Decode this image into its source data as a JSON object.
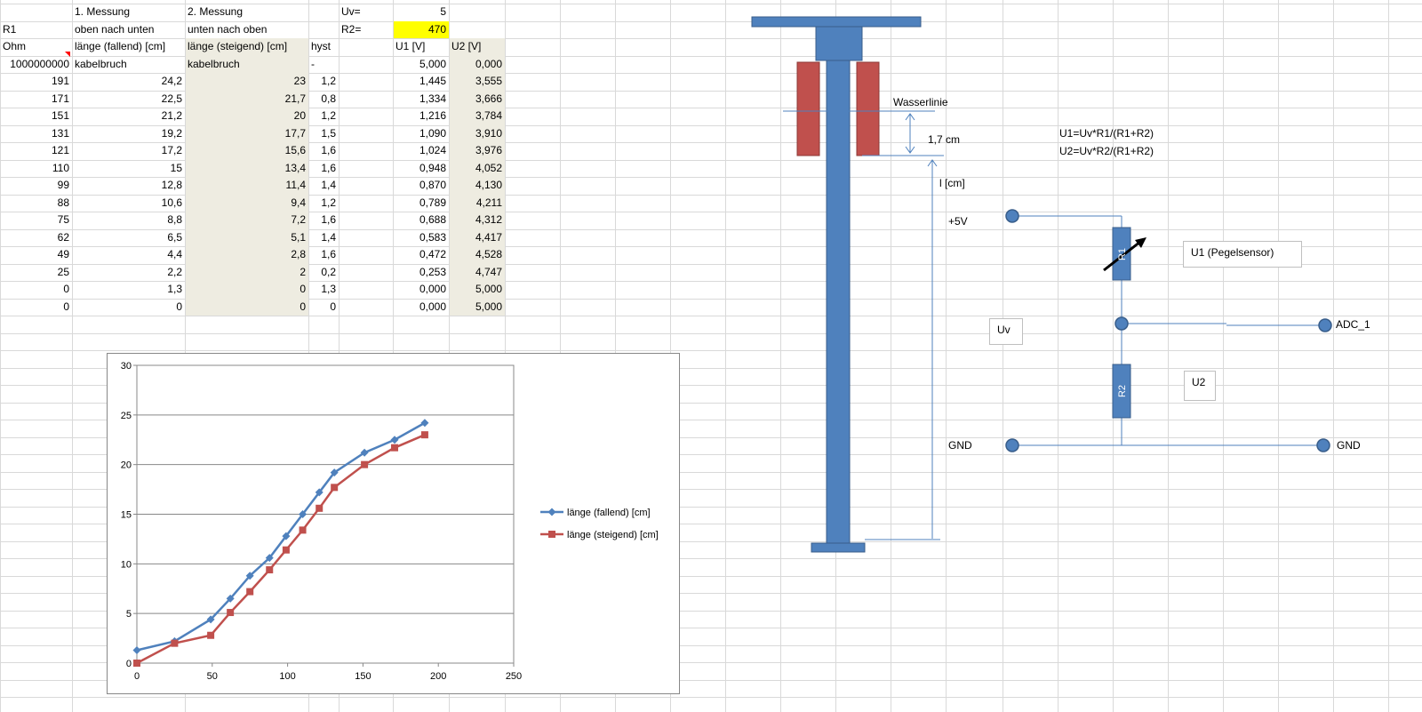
{
  "sheet": {
    "top_rows": [
      {
        "b": "1. Messung",
        "c": "2. Messung",
        "e": "Uv=",
        "f": "5"
      },
      {
        "a": "R1",
        "b": "oben nach unten",
        "c": "unten nach oben",
        "e": "R2=",
        "f": "470"
      },
      {
        "a": "Ohm",
        "b": "länge (fallend) [cm]",
        "c": "länge (steigend)  [cm]",
        "d": "hyst",
        "f": "U1 [V]",
        "g": "U2  [V]"
      },
      {
        "a": "1000000000",
        "b": "kabelbruch",
        "c": "kabelbruch",
        "d": "-",
        "f": "5,000",
        "g": "0,000"
      }
    ],
    "rows": [
      {
        "a": "191",
        "b": "24,2",
        "c": "23",
        "d": "1,2",
        "f": "1,445",
        "g": "3,555"
      },
      {
        "a": "171",
        "b": "22,5",
        "c": "21,7",
        "d": "0,8",
        "f": "1,334",
        "g": "3,666"
      },
      {
        "a": "151",
        "b": "21,2",
        "c": "20",
        "d": "1,2",
        "f": "1,216",
        "g": "3,784"
      },
      {
        "a": "131",
        "b": "19,2",
        "c": "17,7",
        "d": "1,5",
        "f": "1,090",
        "g": "3,910"
      },
      {
        "a": "121",
        "b": "17,2",
        "c": "15,6",
        "d": "1,6",
        "f": "1,024",
        "g": "3,976"
      },
      {
        "a": "110",
        "b": "15",
        "c": "13,4",
        "d": "1,6",
        "f": "0,948",
        "g": "4,052"
      },
      {
        "a": "99",
        "b": "12,8",
        "c": "11,4",
        "d": "1,4",
        "f": "0,870",
        "g": "4,130"
      },
      {
        "a": "88",
        "b": "10,6",
        "c": "9,4",
        "d": "1,2",
        "f": "0,789",
        "g": "4,211"
      },
      {
        "a": "75",
        "b": "8,8",
        "c": "7,2",
        "d": "1,6",
        "f": "0,688",
        "g": "4,312"
      },
      {
        "a": "62",
        "b": "6,5",
        "c": "5,1",
        "d": "1,4",
        "f": "0,583",
        "g": "4,417"
      },
      {
        "a": "49",
        "b": "4,4",
        "c": "2,8",
        "d": "1,6",
        "f": "0,472",
        "g": "4,528"
      },
      {
        "a": "25",
        "b": "2,2",
        "c": "2",
        "d": "0,2",
        "f": "0,253",
        "g": "4,747"
      },
      {
        "a": "0",
        "b": "1,3",
        "c": "0",
        "d": "1,3",
        "f": "0,000",
        "g": "5,000"
      },
      {
        "a": "0",
        "b": "0",
        "c": "0",
        "d": "0",
        "f": "0,000",
        "g": "5,000"
      }
    ],
    "colors": {
      "shade": "#eeece1",
      "highlight": "#ffff00",
      "grid": "#d9d9d9"
    }
  },
  "chart_data": {
    "type": "line",
    "title": "",
    "xlabel": "",
    "ylabel": "",
    "xlim": [
      0,
      250
    ],
    "ylim": [
      0,
      30
    ],
    "xticks": [
      "0",
      "50",
      "100",
      "150",
      "200",
      "250"
    ],
    "yticks": [
      "0",
      "5",
      "10",
      "15",
      "20",
      "25",
      "30"
    ],
    "grid": "horizontal",
    "legend": "right",
    "series": [
      {
        "name": "länge (fallend) [cm]",
        "color": "#4f81bd",
        "marker": "diamond",
        "x": [
          191,
          171,
          151,
          131,
          121,
          110,
          99,
          88,
          75,
          62,
          49,
          25,
          0
        ],
        "y": [
          24.2,
          22.5,
          21.2,
          19.2,
          17.2,
          15,
          12.8,
          10.6,
          8.8,
          6.5,
          4.4,
          2.2,
          1.3
        ]
      },
      {
        "name": "länge (steigend)  [cm]",
        "color": "#c0504d",
        "marker": "square",
        "x": [
          191,
          171,
          151,
          131,
          121,
          110,
          99,
          88,
          75,
          62,
          49,
          25,
          0,
          0
        ],
        "y": [
          23,
          21.7,
          20,
          17.7,
          15.6,
          13.4,
          11.4,
          9.4,
          7.2,
          5.1,
          2.8,
          2,
          0,
          0
        ]
      }
    ]
  },
  "diagram": {
    "wasserlinie": "Wasserlinie",
    "depth_label": "1,7 cm",
    "length_label": "l [cm]",
    "formula1": "U1=Uv*R1/(R1+R2)",
    "formula2": "U2=Uv*R2/(R1+R2)",
    "plus5v": "+5V",
    "r1": "R1",
    "r2": "R2",
    "u1_box": "U1 (Pegelsensor)",
    "uv_box": "Uv",
    "u2_box": "U2",
    "adc": "ADC_1",
    "gnd_left": "GND",
    "gnd_right": "GND",
    "colors": {
      "pipe": "#4f81bd",
      "pipe_border": "#385d8a",
      "float": "#c0504d",
      "float_border": "#8c3836",
      "wire": "#4f81bd"
    }
  }
}
